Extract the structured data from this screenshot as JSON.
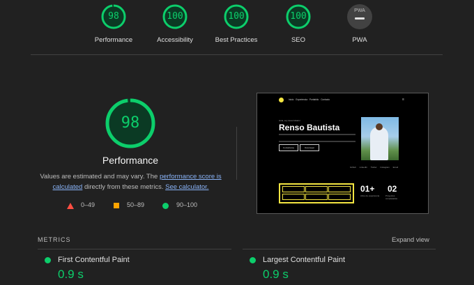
{
  "categories": [
    {
      "label": "Performance",
      "score": "98",
      "score_fraction": 0.98
    },
    {
      "label": "Accessibility",
      "score": "100",
      "score_fraction": 1.0
    },
    {
      "label": "Best Practices",
      "score": "100",
      "score_fraction": 1.0
    },
    {
      "label": "SEO",
      "score": "100",
      "score_fraction": 1.0
    },
    {
      "label": "PWA",
      "badge": "PWA"
    }
  ],
  "performance": {
    "score": "98",
    "score_fraction": 0.98,
    "title": "Performance",
    "desc_part1": "Values are estimated and may vary. The ",
    "desc_link1": "performance score is calculated",
    "desc_part2": " directly from these metrics. ",
    "desc_link2": "See calculator.",
    "legend": [
      {
        "range": "0–49",
        "color": "#ff4e42"
      },
      {
        "range": "50–89",
        "color": "#ffa400"
      },
      {
        "range": "90–100",
        "color": "#0cce6b"
      }
    ]
  },
  "screenshot": {
    "nav": "Inicio Experiencia Portafolio Contacto",
    "tagline": "Hola, soy desarrollador",
    "name": "Renso Bautista",
    "btn1": "Contáctame",
    "btn2": "Descargar",
    "socials": "Github LinkedIn Twitter Instagram Email",
    "stat1_num": "01+",
    "stat1_cap": "Años de experiencia",
    "stat2_num": "02",
    "stat2_cap": "Proyectos completados"
  },
  "metrics": {
    "heading": "METRICS",
    "expand": "Expand view",
    "items": [
      {
        "title": "First Contentful Paint",
        "value": "0.9 s"
      },
      {
        "title": "Largest Contentful Paint",
        "value": "0.9 s"
      }
    ]
  },
  "colors": {
    "pass": "#0cce6b",
    "average": "#ffa400",
    "fail": "#ff4e42",
    "background": "#212121"
  }
}
